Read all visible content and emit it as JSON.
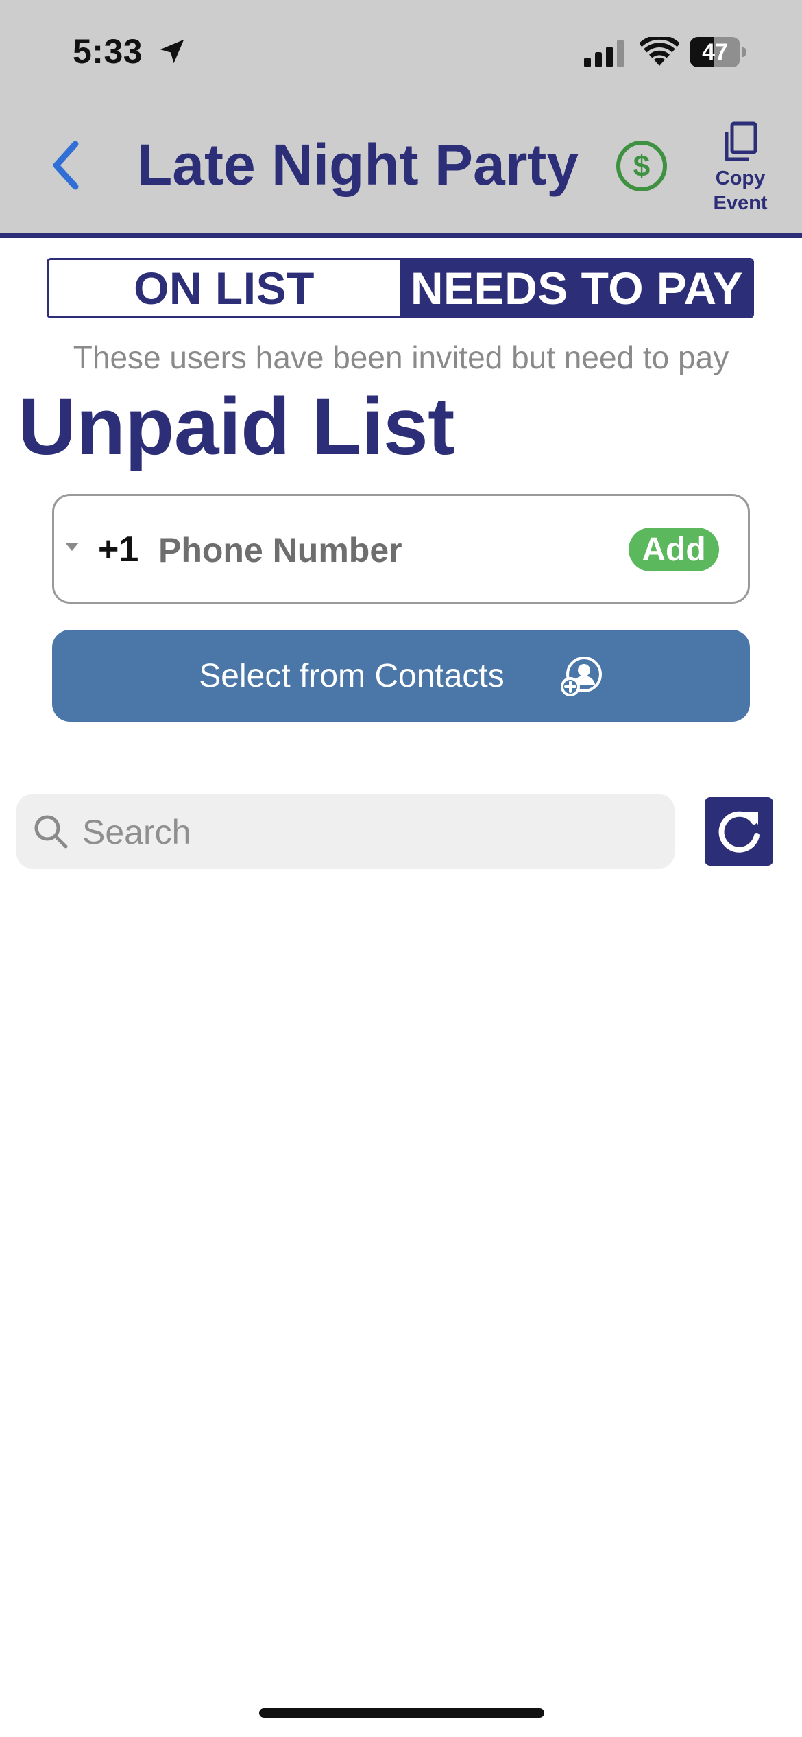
{
  "status_bar": {
    "time": "5:33",
    "battery_level": "47",
    "icons": [
      "location-arrow-icon",
      "cellular-signal-icon",
      "wifi-icon",
      "battery-icon"
    ]
  },
  "header": {
    "title": "Late Night Party",
    "paid_icon": "dollar-circle-icon",
    "copy_event_label": "Copy Event",
    "back_icon": "chevron-left-icon"
  },
  "tabs": [
    {
      "label": "ON LIST",
      "selected": false
    },
    {
      "label": "NEEDS TO PAY",
      "selected": true
    }
  ],
  "subtitle": "These users have been invited but need to pay",
  "list_title": "Unpaid List",
  "phone_entry": {
    "country_code": "+1",
    "value": "",
    "placeholder": "Phone Number",
    "add_label": "Add"
  },
  "contacts_button": {
    "label": "Select from Contacts",
    "icon": "add-contact-icon"
  },
  "search": {
    "value": "",
    "placeholder": "Search",
    "refresh_icon": "refresh-icon"
  },
  "colors": {
    "brand_navy": "#2d2e78",
    "header_gray": "#cdcdcd",
    "add_green": "#5cb85c",
    "contacts_blue": "#4a76a8",
    "back_blue": "#2f6fd6",
    "dollar_green": "#3f9142"
  }
}
